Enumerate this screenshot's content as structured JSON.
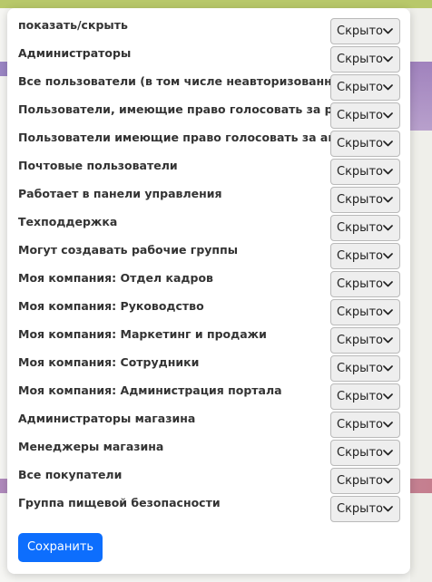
{
  "dialog": {
    "rows": [
      {
        "label": "показать/скрыть",
        "value": "Скрыто"
      },
      {
        "label": "Администраторы",
        "value": "Скрыто"
      },
      {
        "label": "Все пользователи (в том числе неавторизованные)",
        "value": "Скрыто"
      },
      {
        "label": "Пользователи, имеющие право голосовать за рейтинг",
        "value": "Скрыто"
      },
      {
        "label": "Пользователи имеющие право голосовать за авторитет",
        "value": "Скрыто"
      },
      {
        "label": "Почтовые пользователи",
        "value": "Скрыто"
      },
      {
        "label": "Работает в панели управления",
        "value": "Скрыто"
      },
      {
        "label": "Техподдержка",
        "value": "Скрыто"
      },
      {
        "label": "Могут создавать рабочие группы",
        "value": "Скрыто"
      },
      {
        "label": "Моя компания: Отдел кадров",
        "value": "Скрыто"
      },
      {
        "label": "Моя компания: Руководство",
        "value": "Скрыто"
      },
      {
        "label": "Моя компания: Маркетинг и продажи",
        "value": "Скрыто"
      },
      {
        "label": "Моя компания: Сотрудники",
        "value": "Скрыто"
      },
      {
        "label": "Моя компания: Администрация портала",
        "value": "Скрыто"
      },
      {
        "label": "Администраторы магазина",
        "value": "Скрыто"
      },
      {
        "label": "Менеджеры магазина",
        "value": "Скрыто"
      },
      {
        "label": "Все покупатели",
        "value": "Скрыто"
      },
      {
        "label": "Группа пищевой безопасности",
        "value": "Скрыто"
      }
    ],
    "save_label": "Сохранить"
  },
  "icons": {
    "select_arrow": "chevron-down-icon"
  },
  "colors": {
    "accent": "#0d6efd",
    "select_bg": "#eeeeee",
    "label_text": "#333333"
  }
}
